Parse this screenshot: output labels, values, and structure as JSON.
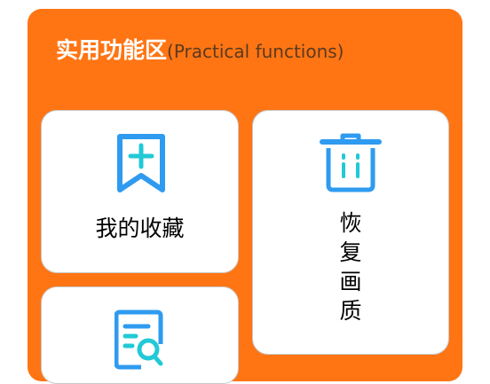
{
  "panel": {
    "title": "实用功能区",
    "subtitle": "(Practical functions)"
  },
  "cards": {
    "favorites": {
      "label": "我的收藏",
      "icon": "bookmark-add-icon"
    },
    "restore": {
      "label_chars": [
        "恢",
        "复",
        "画",
        "质"
      ],
      "icon": "trash-icon"
    },
    "third": {
      "icon": "document-search-icon"
    }
  },
  "colors": {
    "panel_bg": "#FF7514",
    "icon_blue": "#2F9BF0",
    "icon_cyan": "#22C9D6"
  }
}
